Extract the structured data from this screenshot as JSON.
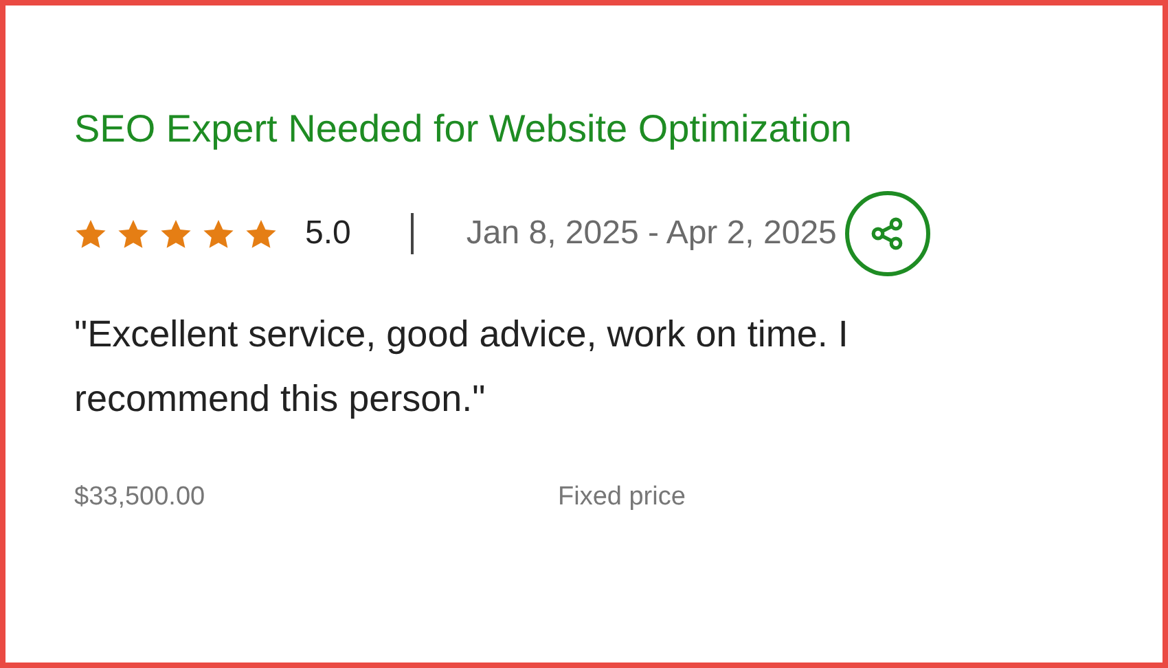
{
  "review": {
    "title": "SEO Expert Needed for Website Optimization",
    "stars": 5,
    "rating": "5.0",
    "dates": "Jan 8, 2025 - Apr 2, 2025",
    "quote": "\"Excellent service, good advice, work on time. I recommend this person.\"",
    "amount": "$33,500.00",
    "price_type": "Fixed price"
  }
}
